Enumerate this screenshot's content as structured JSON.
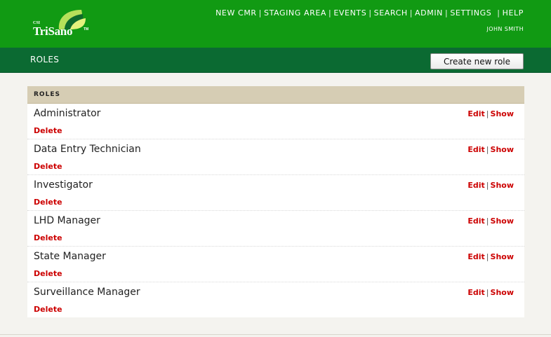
{
  "header": {
    "logo": {
      "prefix": "CSI",
      "brand": "TriSano",
      "tm": "TM"
    },
    "nav": [
      "NEW CMR",
      "STAGING AREA",
      "EVENTS",
      "SEARCH",
      "ADMIN",
      "SETTINGS",
      "HELP"
    ],
    "nav_separator": "|",
    "user": "JOHN SMITH"
  },
  "subheader": {
    "title": "ROLES",
    "create_button": "Create new role"
  },
  "panel": {
    "heading": "ROLES",
    "edit_label": "Edit",
    "show_label": "Show",
    "delete_label": "Delete",
    "action_separator": "|",
    "roles": [
      "Administrator",
      "Data Entry Technician",
      "Investigator",
      "LHD Manager",
      "State Manager",
      "Surveillance Manager"
    ]
  },
  "colors": {
    "topbar": "#119a13",
    "subbar": "#0b6a32",
    "panel_header": "#d6cdb4",
    "link_red": "#cc0000"
  }
}
